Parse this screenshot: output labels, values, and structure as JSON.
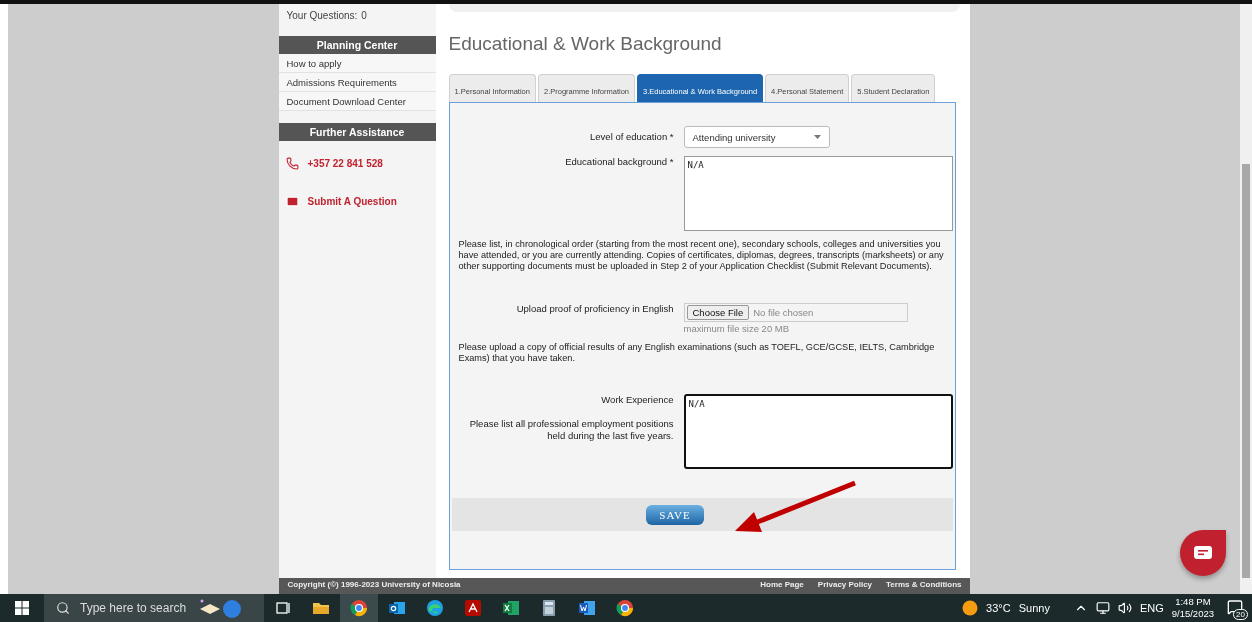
{
  "sidebar": {
    "questions_label": "Your Questions:",
    "questions_count": "0",
    "planning_center": {
      "title": "Planning Center",
      "links": [
        "How to apply",
        "Admissions Requirements",
        "Document Download Center"
      ]
    },
    "further_assistance": {
      "title": "Further Assistance",
      "contacts": [
        {
          "kind": "phone",
          "text": "+357 22 841 528"
        },
        {
          "kind": "message",
          "text": "Submit A Question"
        }
      ]
    }
  },
  "main": {
    "title": "Educational & Work Background",
    "tabs": [
      {
        "label": "1.Personal Information",
        "selected": false
      },
      {
        "label": "2.Programme Information",
        "selected": false
      },
      {
        "label": "3.Educational & Work Background",
        "selected": true
      },
      {
        "label": "4.Personal Statement",
        "selected": false
      },
      {
        "label": "5.Student Declaration",
        "selected": false
      }
    ],
    "form": [
      {
        "kind": "select",
        "label": "Level of education *",
        "value": "Attending university"
      },
      {
        "kind": "textarea",
        "label": "Educational background *",
        "value": "N/A",
        "focused": false
      },
      {
        "kind": "note",
        "text": "Please list, in chronological order (starting from the most recent one), secondary schools, colleges and universities you have attended, or you are currently attending. Copies of certificates, diplomas, degrees, transcripts (marksheets) or any other supporting documents must be uploaded in Step 2 of your Application Checklist (Submit Relevant Documents)."
      },
      {
        "kind": "file",
        "label": "Upload proof of proficiency in English",
        "button": "Choose File",
        "status": "No file chosen",
        "hint": "maximum file size 20 MB"
      },
      {
        "kind": "note",
        "text": "Please upload a copy of official results of any English examinations (such as TOEFL, GCE/GCSE, IELTS, Cambridge Exams) that you have taken."
      },
      {
        "kind": "textarea",
        "label": "Work Experience",
        "sublabel": "Please list all professional employment positions held during the last five years.",
        "value": "N/A",
        "focused": true
      }
    ],
    "save_button": "SAVE"
  },
  "footer": {
    "copyright": "Copyright (©) 1996-2023 University of Nicosia",
    "links": [
      "Home Page",
      "Privacy Policy",
      "Terms & Conditions"
    ]
  },
  "taskbar": {
    "search_placeholder": "Type here to search",
    "apps": [
      {
        "kind": "taskview",
        "selected": false
      },
      {
        "kind": "folder",
        "selected": false
      },
      {
        "kind": "chrome",
        "selected": true
      },
      {
        "kind": "outlook",
        "selected": false
      },
      {
        "kind": "edge",
        "selected": false
      },
      {
        "kind": "pdf",
        "selected": false
      },
      {
        "kind": "excel",
        "selected": false
      },
      {
        "kind": "calculator",
        "selected": false
      },
      {
        "kind": "word",
        "selected": false
      },
      {
        "kind": "chrome",
        "selected": false
      }
    ],
    "weather": {
      "temperature": "33°C",
      "condition": "Sunny"
    },
    "language": "ENG",
    "time": "1:48 PM",
    "date": "9/15/2023",
    "notifications": "20"
  }
}
